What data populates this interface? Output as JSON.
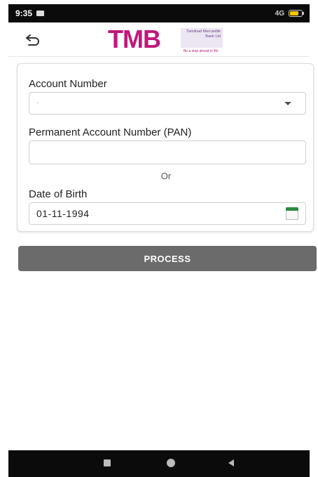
{
  "status_bar": {
    "time": "9:35",
    "signal": "4G"
  },
  "header": {
    "logo_text": "TMB",
    "logo_box_text": "Tamilnad Mercantile Bank Ltd",
    "logo_tagline": "Be a step ahead in life",
    "brand_color": "#c2187a"
  },
  "form": {
    "account_number_label": "Account Number",
    "account_number_value": ".",
    "pan_label": "Permanent Account Number (PAN)",
    "pan_value": "",
    "or_text": "Or",
    "dob_label": "Date of Birth",
    "dob_value": "01-11-1994"
  },
  "process_button": {
    "label": "PROCESS",
    "color": "#6b6b6b"
  },
  "icons": {
    "back": "back-arrow-icon",
    "dropdown": "chevron-down-icon",
    "calendar": "calendar-icon",
    "nav_recent": "square-icon",
    "nav_home": "circle-icon",
    "nav_back": "triangle-back-icon"
  }
}
